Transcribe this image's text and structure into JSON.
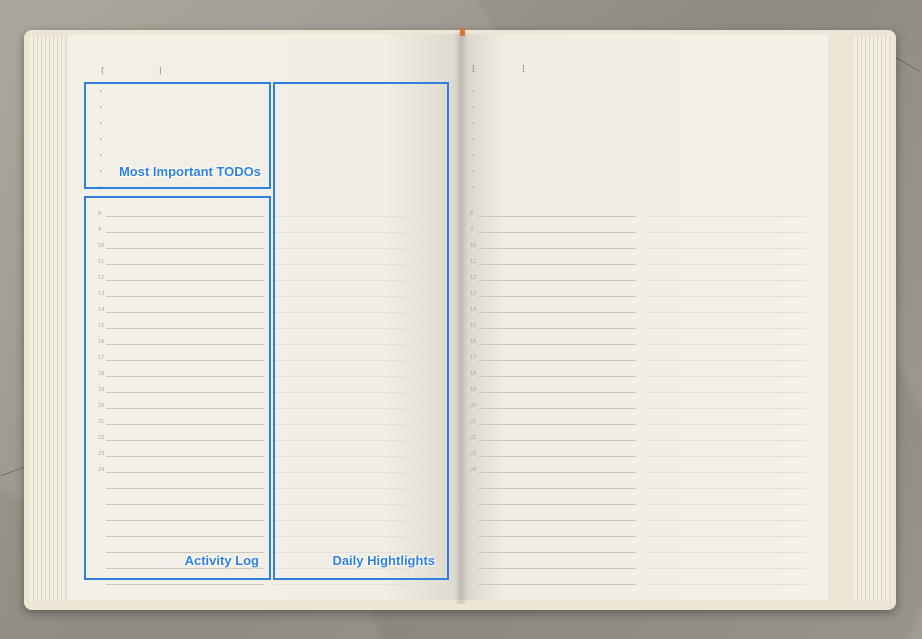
{
  "zones": {
    "todos_label": "Most Important TODOs",
    "activity_label": "Activity Log",
    "highlights_label": "Daily Hightlights",
    "accent_color": "#2f7fe0"
  },
  "left_page": {
    "hours": [
      "8",
      "9",
      "10",
      "11",
      "12",
      "13",
      "14",
      "15",
      "16",
      "17",
      "18",
      "19",
      "20",
      "21",
      "22",
      "23",
      "24"
    ]
  },
  "right_page": {
    "hours": [
      "8",
      "9",
      "10",
      "11",
      "12",
      "13",
      "14",
      "15",
      "16",
      "17",
      "18",
      "19",
      "20",
      "21",
      "22",
      "23",
      "24"
    ]
  },
  "brackets": {
    "open": "[",
    "close": "]"
  }
}
